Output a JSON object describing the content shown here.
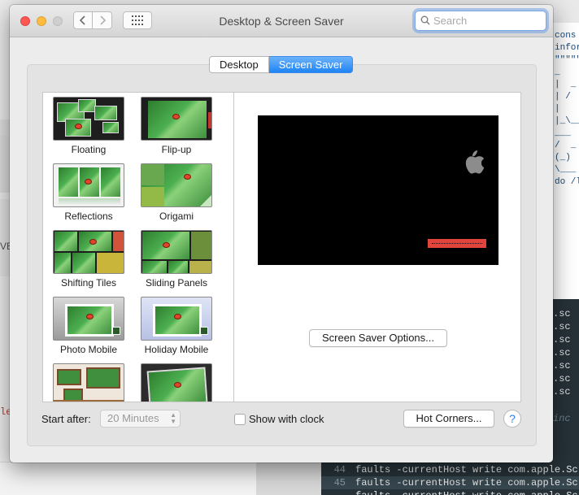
{
  "window": {
    "title": "Desktop & Screen Saver"
  },
  "search": {
    "placeholder": "Search"
  },
  "tabs": [
    {
      "label": "Desktop",
      "active": false
    },
    {
      "label": "Screen Saver",
      "active": true
    }
  ],
  "savers": [
    {
      "label": "Floating"
    },
    {
      "label": "Flip-up"
    },
    {
      "label": "Reflections"
    },
    {
      "label": "Origami"
    },
    {
      "label": "Shifting Tiles"
    },
    {
      "label": "Sliding Panels"
    },
    {
      "label": "Photo Mobile"
    },
    {
      "label": "Holiday Mobile"
    }
  ],
  "preview": {
    "options_button": "Screen Saver Options..."
  },
  "footer": {
    "start_after_label": "Start after:",
    "start_after_value": "20 Minutes",
    "show_clock_label": "Show with clock",
    "hot_corners_button": "Hot Corners...",
    "help_label": "?"
  },
  "background": {
    "right_text": [
      "cons",
      "infor",
      "\"\"\"\"\"\"",
      "_",
      "|  _",
      "| /  _",
      "|    |",
      "|_\\__",
      "___",
      "/  _ \\",
      "(_)",
      "\\___",
      "do /l"
    ],
    "terminal_right": [
      ".sc",
      ".sc",
      ".sc",
      ".sc",
      ".sc",
      ".sc",
      ".sc"
    ],
    "terminal_comment": "inc",
    "terminal_lines": [
      {
        "num": "44",
        "code": "faults -currentHost write com.apple.Sc"
      },
      {
        "num": "45",
        "code": "faults -currentHost write com.apple.Sc"
      },
      {
        "num": "",
        "code": "faults -currentHost write com.apple.Sc"
      }
    ],
    "left_fragment": "VE",
    "left_fragment2": "le"
  },
  "colors": {
    "accent": "#1f84f5",
    "terminal_bg": "#263238",
    "preview_bg": "#000000",
    "preview_bar": "#e0443c"
  }
}
